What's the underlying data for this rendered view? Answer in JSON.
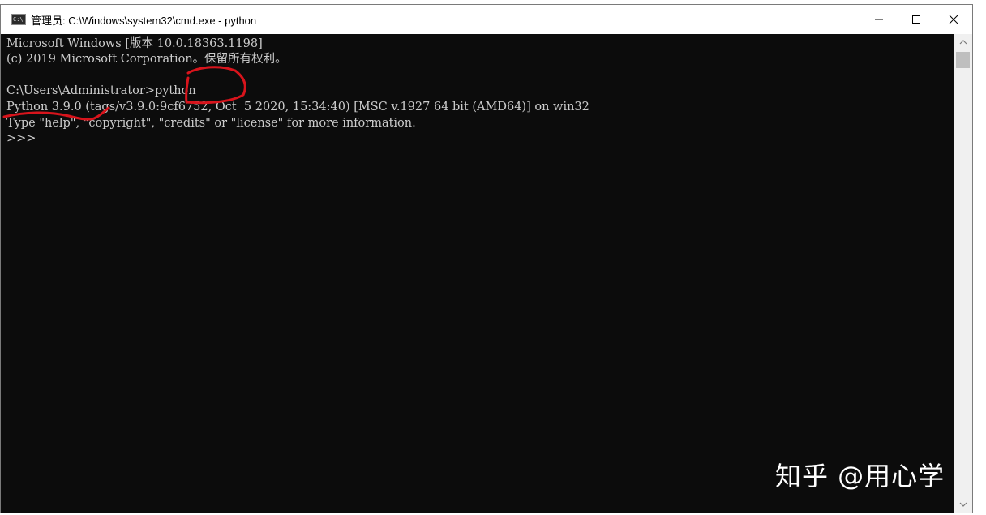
{
  "window": {
    "title": "管理员: C:\\Windows\\system32\\cmd.exe - python",
    "app_icon_text": "C:\\",
    "controls": [
      "minimize",
      "maximize",
      "close"
    ]
  },
  "console": {
    "lines": [
      "Microsoft Windows [版本 10.0.18363.1198]",
      "(c) 2019 Microsoft Corporation。保留所有权利。",
      "",
      "C:\\Users\\Administrator>python",
      "Python 3.9.0 (tags/v3.9.0:9cf6752, Oct  5 2020, 15:34:40) [MSC v.1927 64 bit (AMD64)] on win32",
      "Type \"help\", \"copyright\", \"credits\" or \"license\" for more information.",
      ">>>"
    ]
  },
  "watermark": "知乎 @用心学",
  "colors": {
    "console_bg": "#0c0c0c",
    "console_text": "#cccccc",
    "annotation_ink": "#d8141c",
    "titlebar_bg": "#ffffff"
  }
}
